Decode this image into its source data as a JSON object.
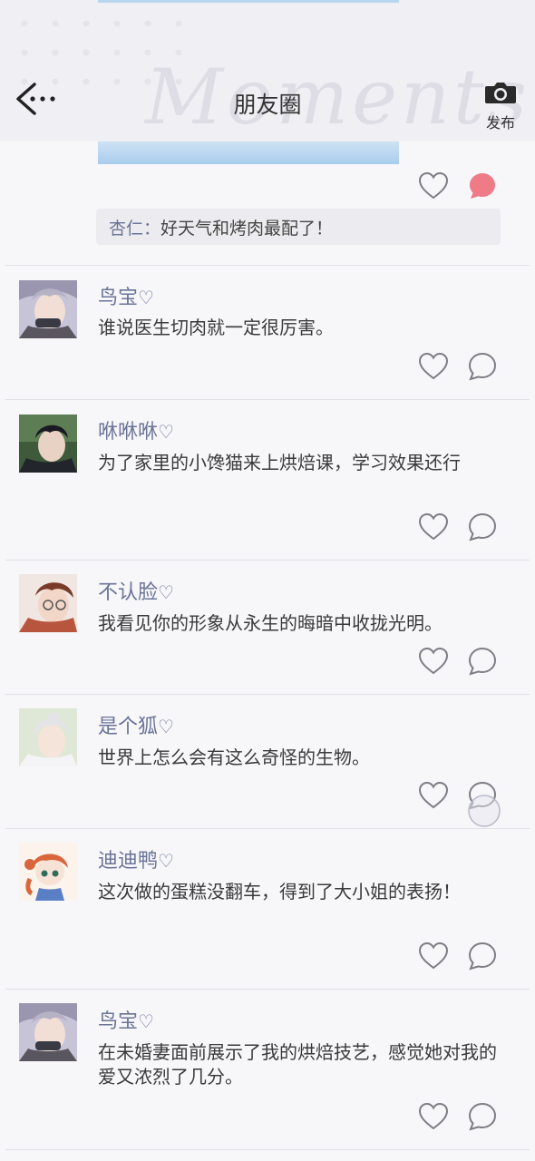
{
  "header": {
    "title": "朋友圈",
    "watermark": "Moments",
    "publish_label": "发布",
    "back_icon": "back-arrow-icon",
    "camera_icon": "camera-icon"
  },
  "colors": {
    "name": "#6a7496",
    "liked": "#ee7b86",
    "icon_stroke": "#7d7d85",
    "background": "#f7f6f9"
  },
  "partial_post": {
    "liked_comment": true,
    "reply": {
      "name": "杏仁",
      "separator": "：",
      "text": "好天气和烤肉最配了！"
    }
  },
  "posts": [
    {
      "name": "鸟宝",
      "name_suffix": "♡",
      "text": "谁说医生切肉就一定很厉害。",
      "avatar": "silver-hair-man"
    },
    {
      "name": "咻咻咻",
      "name_suffix": "♡",
      "text": "为了家里的小馋猫来上烘焙课，学习效果还行",
      "avatar": "dark-hair-man"
    },
    {
      "name": "不认脸",
      "name_suffix": "♡",
      "text": "我看见你的形象从永生的晦暗中收拢光明。",
      "avatar": "glasses-man"
    },
    {
      "name": "是个狐",
      "name_suffix": "♡",
      "text": "世界上怎么会有这么奇怪的生物。",
      "avatar": "white-hair-man"
    },
    {
      "name": "迪迪鸭",
      "name_suffix": "♡",
      "text": "这次做的蛋糕没翻车，得到了大小姐的表扬！",
      "avatar": "chibi-girl"
    },
    {
      "name": "鸟宝",
      "name_suffix": "♡",
      "text": "在未婚妻面前展示了我的烘焙技艺，感觉她对我的爱又浓烈了几分。",
      "avatar": "silver-hair-man"
    }
  ]
}
